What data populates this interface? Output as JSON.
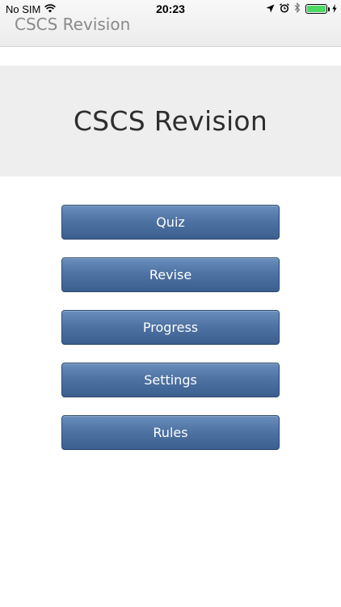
{
  "status_bar": {
    "carrier": "No SIM",
    "time": "20:23",
    "icons": [
      "wifi-icon",
      "location-arrow-icon",
      "alarm-icon",
      "bluetooth-icon",
      "battery-icon",
      "charging-bolt-icon"
    ],
    "battery_color": "#4cd964"
  },
  "nav": {
    "title": "CSCS Revision"
  },
  "banner": {
    "title": "CSCS Revision"
  },
  "menu": {
    "items": [
      {
        "label": "Quiz"
      },
      {
        "label": "Revise"
      },
      {
        "label": "Progress"
      },
      {
        "label": "Settings"
      },
      {
        "label": "Rules"
      }
    ],
    "button_color": "#4f73a3"
  }
}
